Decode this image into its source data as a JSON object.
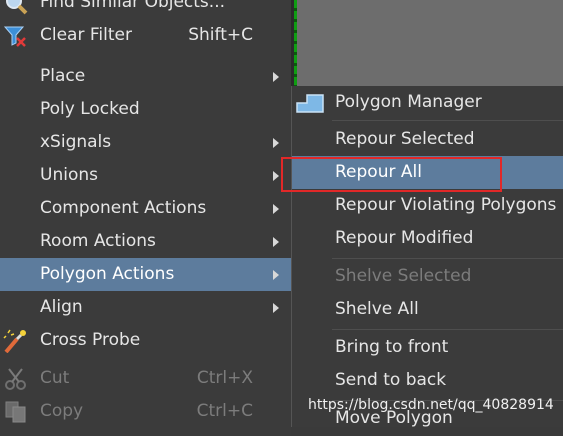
{
  "main_menu": {
    "items": [
      {
        "label": "Find Similar Objects..."
      },
      {
        "label": "Clear Filter",
        "shortcut": "Shift+C"
      },
      {
        "label": "Place"
      },
      {
        "label": "Poly Locked"
      },
      {
        "label": "xSignals"
      },
      {
        "label": "Unions"
      },
      {
        "label": "Component Actions"
      },
      {
        "label": "Room Actions"
      },
      {
        "label": "Polygon Actions"
      },
      {
        "label": "Align"
      },
      {
        "label": "Cross Probe"
      },
      {
        "label": "Cut",
        "shortcut": "Ctrl+X"
      },
      {
        "label": "Copy",
        "shortcut": "Ctrl+C"
      }
    ]
  },
  "submenu": {
    "items": [
      {
        "label": "Polygon Manager"
      },
      {
        "label": "Repour Selected"
      },
      {
        "label": "Repour All"
      },
      {
        "label": "Repour Violating Polygons"
      },
      {
        "label": "Repour Modified"
      },
      {
        "label": "Shelve Selected"
      },
      {
        "label": "Shelve All"
      },
      {
        "label": "Bring to front"
      },
      {
        "label": "Send to back"
      },
      {
        "label": "Move Polygon"
      }
    ]
  },
  "watermark": "https://blog.csdn.net/qq_40828914",
  "colors": {
    "highlight": "#5d7c9d",
    "menu_bg": "#3b3b3b",
    "annotation_box": "#e12828",
    "disabled_text": "#7c7c7c"
  }
}
